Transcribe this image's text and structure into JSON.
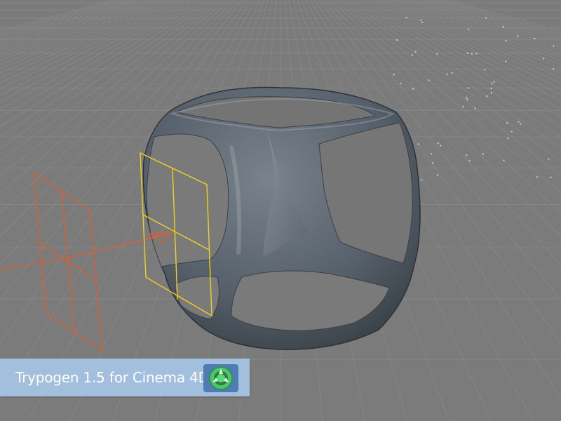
{
  "banner": {
    "title": "Trypogen 1.5 for Cinema 4D",
    "logo_icon": "trypogen-logo-icon",
    "background_color": "#a8c8ec"
  },
  "viewport": {
    "background_color": "#7b7b7b",
    "grid_color": "#8e8e8e"
  },
  "objects": {
    "mesh": {
      "name": "trypogen-cube-mesh",
      "color": "#4e5760"
    },
    "camera_gizmo": {
      "name": "camera-frustum",
      "color": "#f0d21e"
    },
    "light_gizmo": {
      "name": "light-gizmo",
      "color": "#e85a28"
    }
  }
}
